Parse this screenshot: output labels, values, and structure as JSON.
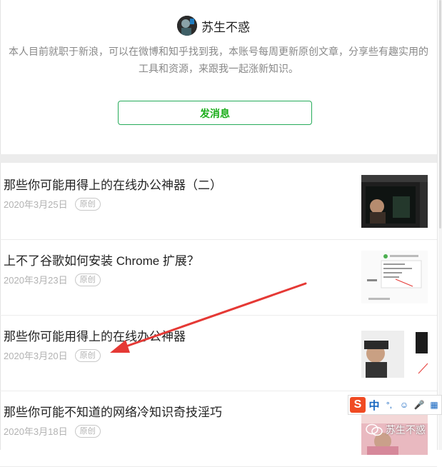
{
  "profile": {
    "author": "苏生不惑",
    "bio": "本人目前就职于新浪，可以在微博和知乎找到我，本账号每周更新原创文章，分享些有趣实用的工具和资源，来跟我一起涨新知识。",
    "message_button": "发消息"
  },
  "articles": [
    {
      "title": "那些你可能用得上的在线办公神器（二）",
      "date": "2020年3月25日",
      "tag": "原创"
    },
    {
      "title": "上不了谷歌如何安装 Chrome 扩展？",
      "date": "2020年3月23日",
      "tag": "原创"
    },
    {
      "title": "那些你可能用得上的在线办公神器",
      "date": "2020年3月20日",
      "tag": "原创"
    },
    {
      "title": "那些你可能不知道的网络冷知识奇技淫巧",
      "date": "2020年3月18日",
      "tag": "原创"
    }
  ],
  "ime": {
    "logo": "S",
    "mode": "中",
    "punct": "°,",
    "smile": "☺",
    "mic": "🎤",
    "grid": "▦"
  },
  "watermark": "苏生不惑",
  "colors": {
    "accent_green": "#1aad19",
    "annotation_red": "#e53935",
    "ime_orange": "#f04b23"
  }
}
